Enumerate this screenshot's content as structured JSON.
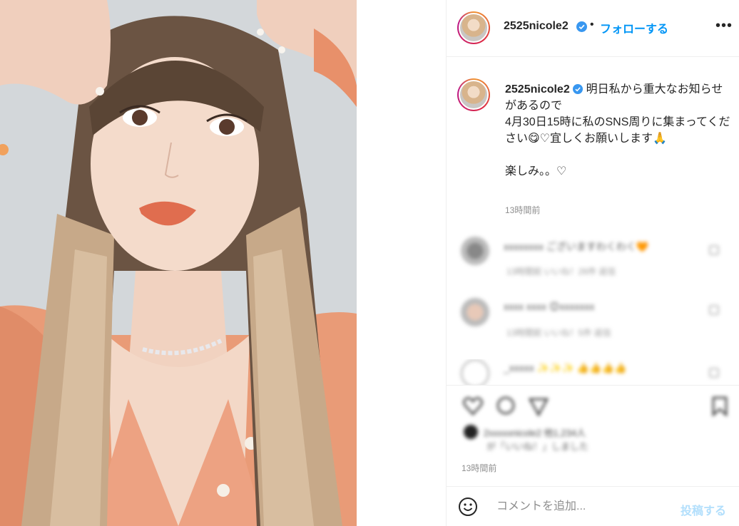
{
  "post": {
    "username": "2525nicole2",
    "follow_label": "フォローする",
    "dot_separator": "•",
    "more_label": "•••"
  },
  "caption": {
    "username": "2525nicole2",
    "line1": "明日私から重大なお知らせがあるので",
    "line2": "4月30日15時に私のSNS周りに集まってください😋♡宜しくお願いします🙏",
    "line3": "楽しみ。。♡",
    "time": "13時間前"
  },
  "comments": [
    {
      "text": "xxxxxxxx ございますわくわく🧡",
      "meta": "13時間前 いいね！26件 返信"
    },
    {
      "text": "xxxx xxxx 😊xxxxxxx",
      "meta": "13時間前 いいね！5件 返信"
    },
    {
      "text": "_xxxxx ✨✨✨ 👍👍👍👍",
      "meta": ""
    }
  ],
  "likes": {
    "text": "2xxxxxnicole2 他1,234人",
    "sub": "が「いいね！」しました"
  },
  "post_time": "13時間前",
  "comment_bar": {
    "placeholder": "コメントを追加...",
    "post_label": "投稿する"
  },
  "colors": {
    "accent": "#0095f6",
    "post_disabled": "#b2dffc",
    "muted": "#8e8e8e"
  }
}
